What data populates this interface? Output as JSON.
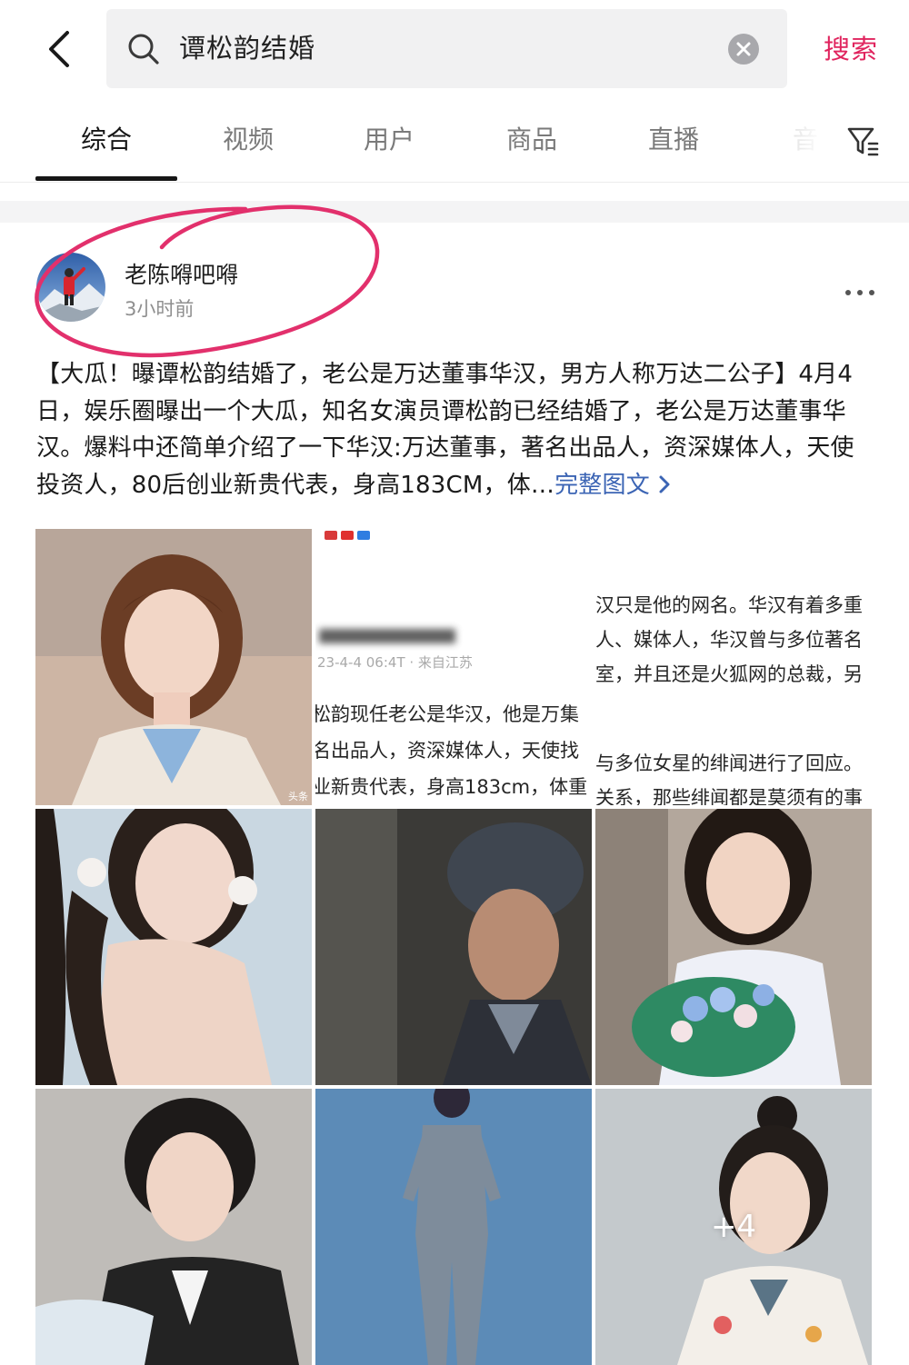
{
  "search": {
    "query": "谭松韵结婚",
    "submit_label": "搜索"
  },
  "tabs": [
    "综合",
    "视频",
    "用户",
    "商品",
    "直播",
    "音"
  ],
  "active_tab": "综合",
  "post": {
    "author": "老陈嘚吧嘚",
    "time": "3小时前",
    "body": "【大瓜！曝谭松韵结婚了，老公是万达董事华汉，男方人称万达二公子】4月4日，娱乐圈曝出一个大瓜，知名女演员谭松韵已经结婚了，老公是万达董事华汉。爆料中还简单介绍了一下华汉:万达董事，著名出品人，资深媒体人，天使投资人，80后创业新贵代表，身高183CM，体…",
    "read_more": "完整图文",
    "extra_images": "+4"
  },
  "screenshot_middle": {
    "meta": "23-4-4 06:4T · 来自江苏",
    "lines": [
      "松韵现任老公是华汉，他是万集",
      "名出品人，资深媒体人，天使找",
      "业新贵代表，身高183cm，体重"
    ]
  },
  "screenshot_right": {
    "lines": [
      "汉只是他的网名。华汉有着多重",
      "人、媒体人，华汉曾与多位著名",
      "室，并且还是火狐网的总裁，另",
      "与多位女星的绯闻进行了回应。",
      "关系，那些绯闻都是莫须有的事"
    ]
  },
  "watermark": "头条",
  "colors": {
    "accent": "#e0245e",
    "link": "#3b64b4",
    "annotation": "#e2306c"
  }
}
